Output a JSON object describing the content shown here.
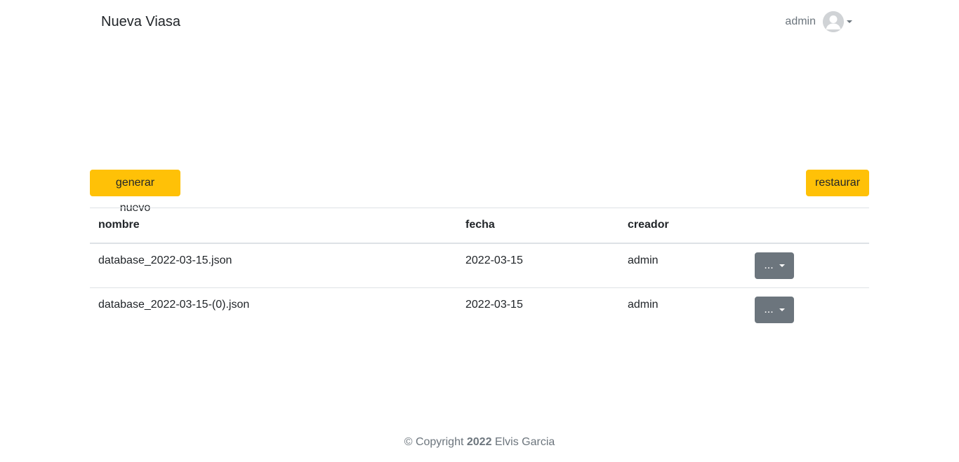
{
  "navbar": {
    "brand": "Nueva Viasa",
    "user": {
      "name": "admin",
      "avatar_icon": "user-avatar-icon"
    }
  },
  "toolbar": {
    "generate_label": "generar nuevo",
    "restore_label": "restaurar"
  },
  "table": {
    "headers": [
      "nombre",
      "fecha",
      "creador",
      ""
    ],
    "rows": [
      {
        "nombre": "database_2022-03-15.json",
        "fecha": "2022-03-15",
        "creador": "admin",
        "actions_label": "..."
      },
      {
        "nombre": "database_2022-03-15-(0).json",
        "fecha": "2022-03-15",
        "creador": "admin",
        "actions_label": "..."
      }
    ]
  },
  "footer": {
    "prefix": "© Copyright",
    "year": "2022",
    "author": "Elvis Garcia"
  },
  "colors": {
    "warning": "#ffc107",
    "secondary": "#6c757d",
    "text": "#212529",
    "border": "#dee2e6"
  }
}
